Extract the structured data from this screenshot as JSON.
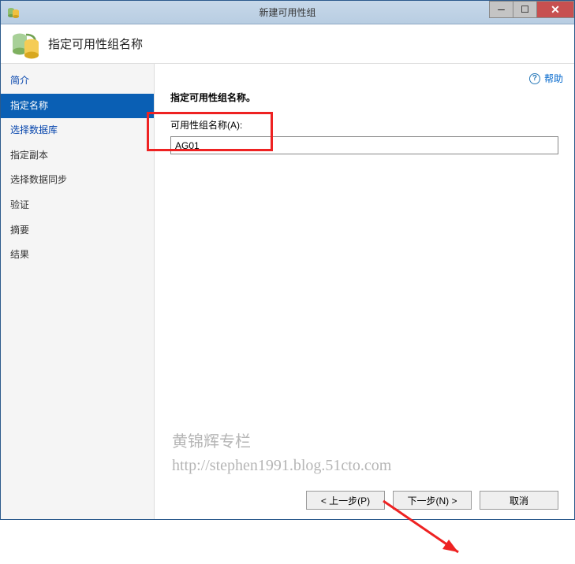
{
  "titlebar": {
    "title": "新建可用性组"
  },
  "header": {
    "title": "指定可用性组名称"
  },
  "help": {
    "label": "帮助"
  },
  "sidebar": {
    "items": [
      {
        "label": "简介",
        "link": true
      },
      {
        "label": "指定名称",
        "selected": true
      },
      {
        "label": "选择数据库",
        "link": true
      },
      {
        "label": "指定副本",
        "plain": true
      },
      {
        "label": "选择数据同步",
        "plain": true
      },
      {
        "label": "验证",
        "plain": true
      },
      {
        "label": "摘要",
        "plain": true
      },
      {
        "label": "结果",
        "plain": true
      }
    ]
  },
  "main": {
    "instruction": "指定可用性组名称。",
    "field_label": "可用性组名称(A):",
    "field_value": "AG01"
  },
  "buttons": {
    "previous": "< 上一步(P)",
    "next": "下一步(N) >",
    "cancel": "取消"
  },
  "watermark": {
    "line1": "黄锦辉专栏",
    "line2": "http://stephen1991.blog.51cto.com"
  }
}
